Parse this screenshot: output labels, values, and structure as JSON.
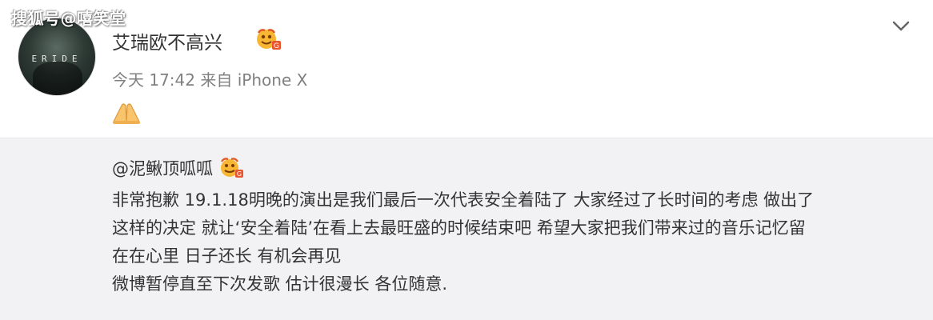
{
  "watermark": {
    "text": "搜狐号@嘻笑堂"
  },
  "post": {
    "username": "艾瑞欧不高兴",
    "meta": "今天 17:42 来自 iPhone X",
    "avatar_text": "ERIDE"
  },
  "repost": {
    "mention": "@泥鳅顶呱呱",
    "lines": [
      "非常抱歉 19.1.18明晚的演出是我们最后一次代表安全着陆了 大家经过了长时间的考虑 做出了",
      "这样的决定 就让‘安全着陆’在看上去最旺盛的时候结束吧 希望大家把我们带来过的音乐记忆留",
      "在在心里 日子还长 有机会再见",
      "微博暂停直至下次发歌 估计很漫长 各位随意."
    ]
  },
  "icons": {
    "verified_badge": "verified-badge-icon",
    "dropdown": "chevron-down-icon",
    "hands": "folded-hands-emoji"
  },
  "colors": {
    "username": "#333333",
    "meta": "#808080",
    "repost_bg": "#f2f2f5",
    "badge_orange": "#f5a623"
  }
}
